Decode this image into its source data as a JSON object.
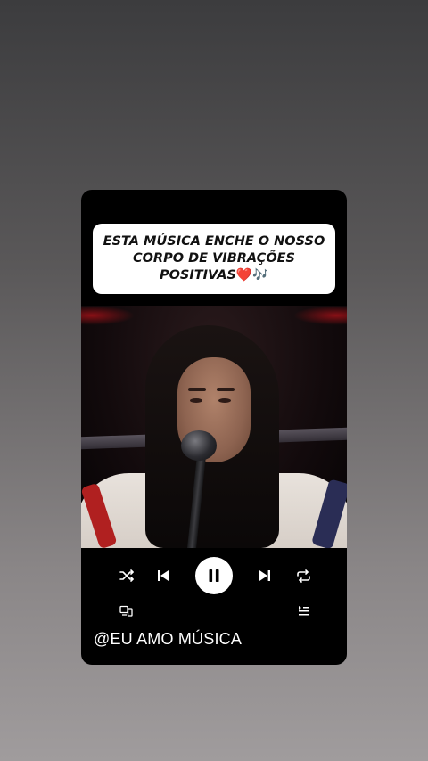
{
  "caption": {
    "line1": "ESTA MÚSICA ENCHE O NOSSO",
    "line2": "CORPO DE VIBRAÇÕES",
    "line3": "POSITIVAS",
    "heart": "❤️",
    "notes": "🎶"
  },
  "player": {
    "shuffle_icon": "shuffle-icon",
    "previous_icon": "previous-icon",
    "pause_icon": "pause-icon",
    "next_icon": "next-icon",
    "repeat_icon": "repeat-icon",
    "devices_icon": "devices-icon",
    "queue_icon": "queue-icon"
  },
  "account": {
    "handle": "@EU AMO MÚSICA"
  },
  "colors": {
    "card": "#000000",
    "caption_bg": "#ffffff",
    "accent_heart": "#e0162b"
  }
}
